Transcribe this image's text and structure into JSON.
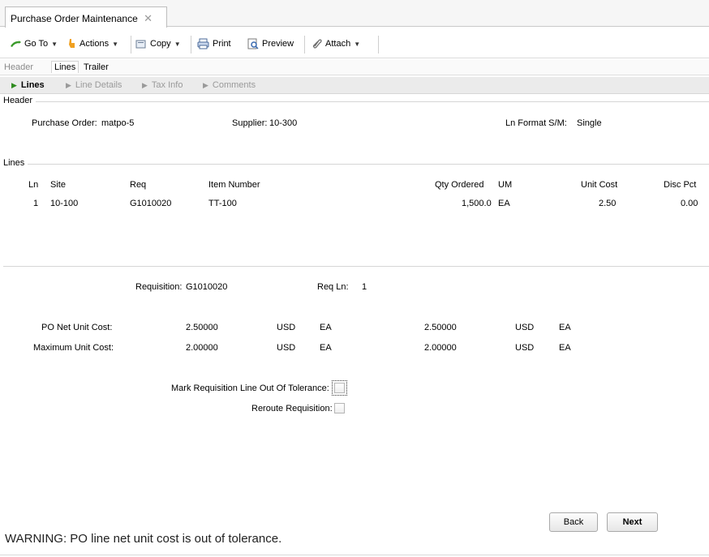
{
  "window": {
    "tab_title": "Purchase Order Maintenance",
    "tab_close": "✕"
  },
  "toolbar": {
    "goto_label": "Go To",
    "actions_label": "Actions",
    "copy_label": "Copy",
    "print_label": "Print",
    "preview_label": "Preview",
    "attach_label": "Attach",
    "icons": [
      "goto-arrow-icon",
      "actions-hand-icon",
      "copy-icon",
      "print-icon",
      "preview-icon",
      "attach-paperclip-icon"
    ]
  },
  "subtabs": [
    "Header",
    "Lines",
    "Trailer"
  ],
  "steps": [
    "Lines",
    "Line Details",
    "Tax Info",
    "Comments"
  ],
  "header_group": {
    "label": "Header",
    "po_label": "Purchase Order:",
    "po_value": "matpo-5",
    "supplier_label": "Supplier:",
    "supplier_value": "10-300",
    "ln_format_label": "Ln Format S/M:",
    "ln_format_value": "Single"
  },
  "lines_group": {
    "label": "Lines",
    "columns": [
      "Ln",
      "Site",
      "Req",
      "Item Number",
      "Qty Ordered",
      "UM",
      "Unit Cost",
      "Disc Pct"
    ],
    "rows": [
      [
        "1",
        "10-100",
        "G1010020",
        "TT-100",
        "1,500.0",
        "EA",
        "2.50",
        "0.00"
      ]
    ]
  },
  "requisition": {
    "req_label": "Requisition:",
    "req_value": "G1010020",
    "reqln_label": "Req Ln:",
    "reqln_value": "1",
    "net_label": "PO Net Unit Cost:",
    "net_value1": "2.50000",
    "net_curr1": "USD",
    "net_um1": "EA",
    "net_value2": "2.50000",
    "net_curr2": "USD",
    "net_um2": "EA",
    "max_label": "Maximum Unit Cost:",
    "max_value1": "2.00000",
    "max_curr1": "USD",
    "max_um1": "EA",
    "max_value2": "2.00000",
    "max_curr2": "USD",
    "max_um2": "EA",
    "mark_label": "Mark Requisition Line Out Of Tolerance:",
    "mark_checked": false,
    "reroute_label": "Reroute Requisition:",
    "reroute_checked": false
  },
  "buttons": {
    "back": "Back",
    "next": "Next"
  },
  "warning_text": "WARNING: PO line net unit cost is out of tolerance.",
  "colors": {
    "step_active": "#2e8b1f",
    "goto_icon": "#3a9a2a",
    "actions_icon": "#f0a020"
  }
}
